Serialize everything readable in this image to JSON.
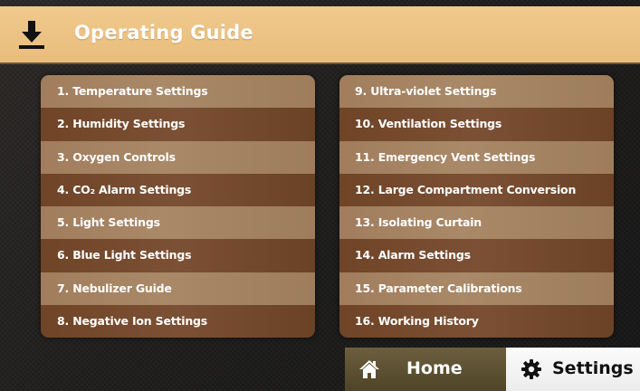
{
  "header": {
    "title": "Operating Guide",
    "icon": "download-icon",
    "background": "#ecc385"
  },
  "guide": {
    "left_items": [
      {
        "label": "1. Temperature Settings"
      },
      {
        "label": "2. Humidity Settings"
      },
      {
        "label": "3. Oxygen Controls"
      },
      {
        "label": "4. CO₂ Alarm Settings"
      },
      {
        "label": "5. Light Settings"
      },
      {
        "label": "6. Blue Light Settings"
      },
      {
        "label": "7. Nebulizer Guide"
      },
      {
        "label": "8. Negative Ion Settings"
      }
    ],
    "right_items": [
      {
        "label": "9. Ultra-violet Settings"
      },
      {
        "label": "10. Ventilation Settings"
      },
      {
        "label": "11. Emergency Vent Settings"
      },
      {
        "label": "12. Large Compartment Conversion"
      },
      {
        "label": "13. Isolating Curtain"
      },
      {
        "label": "14. Alarm Settings"
      },
      {
        "label": "15. Parameter Calibrations"
      },
      {
        "label": "16. Working History"
      }
    ]
  },
  "nav": {
    "home_label": "Home",
    "home_icon": "home-icon",
    "settings_label": "Settings",
    "settings_icon": "gear-icon",
    "active_tab": "Settings"
  }
}
